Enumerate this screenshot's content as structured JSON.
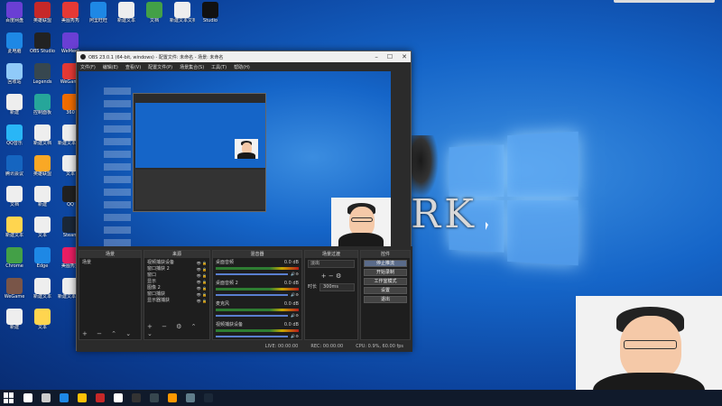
{
  "desktop": {
    "icons": [
      {
        "label": "百度网盘",
        "color": "#6a3fd4"
      },
      {
        "label": "英雄联盟",
        "color": "#c62828"
      },
      {
        "label": "美图秀秀",
        "color": "#e53935"
      },
      {
        "label": "阿里旺旺",
        "color": "#1e88e5"
      },
      {
        "label": "新建文本",
        "color": "#eeeeee"
      },
      {
        "label": "文档",
        "color": "#43a047"
      },
      {
        "label": "新建文本文档",
        "color": "#eeeeee"
      },
      {
        "label": "Studio",
        "color": "#111111"
      },
      {
        "label": "此电脑",
        "color": "#1e88e5"
      },
      {
        "label": "OBS Studio",
        "color": "#222222"
      },
      {
        "label": "WeMeet",
        "color": "#6a3fd4"
      },
      {
        "label": "回收站",
        "color": "#90caf9"
      },
      {
        "label": "Legends",
        "color": "#37474f"
      },
      {
        "label": "WeGame",
        "color": "#e53935"
      },
      {
        "label": "新建",
        "color": "#eeeeee"
      },
      {
        "label": "控制面板",
        "color": "#26a69a"
      },
      {
        "label": "360",
        "color": "#ef6c00"
      },
      {
        "label": "QQ音乐",
        "color": "#29b6f6"
      },
      {
        "label": "新建文档",
        "color": "#eeeeee"
      },
      {
        "label": "新建文本文档",
        "color": "#eeeeee"
      },
      {
        "label": "腾讯会议",
        "color": "#1565c0"
      },
      {
        "label": "英雄联盟",
        "color": "#f9a825"
      },
      {
        "label": "文本",
        "color": "#eeeeee"
      },
      {
        "label": "文档",
        "color": "#eeeeee"
      },
      {
        "label": "新建",
        "color": "#eeeeee"
      },
      {
        "label": "QQ",
        "color": "#212121"
      },
      {
        "label": "新建文本",
        "color": "#ffd54f"
      },
      {
        "label": "文本",
        "color": "#eeeeee"
      },
      {
        "label": "Steam",
        "color": "#1b2838"
      },
      {
        "label": "Chrome",
        "color": "#43a047"
      },
      {
        "label": "Edge",
        "color": "#1e88e5"
      },
      {
        "label": "美图秀秀",
        "color": "#e91e63"
      },
      {
        "label": "WeGame",
        "color": "#795548"
      },
      {
        "label": "新建文本",
        "color": "#eeeeee"
      },
      {
        "label": "新建文本文档",
        "color": "#eeeeee"
      },
      {
        "label": "新建",
        "color": "#eeeeee"
      },
      {
        "label": "文本",
        "color": "#ffd54f"
      }
    ],
    "wallpaper_text": "RK"
  },
  "obs": {
    "title": "OBS 23.0.1 (64-bit, windows) - 配置文件: 未命名 - 场景: 未命名",
    "menu": [
      "文件(F)",
      "编辑(E)",
      "查看(V)",
      "配置文件(P)",
      "场景集合(S)",
      "工具(T)",
      "帮助(H)"
    ],
    "docks": {
      "scenes": {
        "title": "场景",
        "items": [
          "场景"
        ]
      },
      "sources": {
        "title": "来源",
        "items": [
          "视频捕获设备",
          "窗口捕获 2",
          "窗口",
          "显示",
          "图像 2",
          "窗口捕获",
          "显示器捕获"
        ]
      },
      "mixer": {
        "title": "混音器",
        "channels": [
          {
            "name": "桌面音频",
            "db": "0.0 dB"
          },
          {
            "name": "桌面音频 2",
            "db": "0.0 dB"
          },
          {
            "name": "麦克风",
            "db": "0.0 dB"
          },
          {
            "name": "视频捕获设备",
            "db": "0.0 dB"
          }
        ]
      },
      "transitions": {
        "title": "场景过渡",
        "type": "淡出",
        "duration_label": "时长",
        "duration": "300ms"
      },
      "controls": {
        "title": "控件",
        "buttons": [
          "停止推流",
          "开始录制",
          "工作室模式",
          "设置",
          "退出"
        ]
      }
    },
    "status": {
      "live": "LIVE: 00:00:00",
      "rec": "REC: 00:00:00",
      "cpu": "CPU: 0.9%, 60.00 fps"
    }
  },
  "taskbar": {
    "items": [
      {
        "name": "search-icon",
        "color": "#ffffff"
      },
      {
        "name": "task-view-icon",
        "color": "#cccccc"
      },
      {
        "name": "edge-icon",
        "color": "#1e88e5"
      },
      {
        "name": "explorer-icon",
        "color": "#ffc107"
      },
      {
        "name": "league-icon",
        "color": "#c62828"
      },
      {
        "name": "qq-icon",
        "color": "#ffffff"
      },
      {
        "name": "obs-icon",
        "color": "#333333"
      },
      {
        "name": "app-icon",
        "color": "#37474f"
      },
      {
        "name": "browser-icon",
        "color": "#ff9800"
      },
      {
        "name": "wegame-icon",
        "color": "#607d8b"
      },
      {
        "name": "steam-icon",
        "color": "#1b2838"
      }
    ]
  }
}
